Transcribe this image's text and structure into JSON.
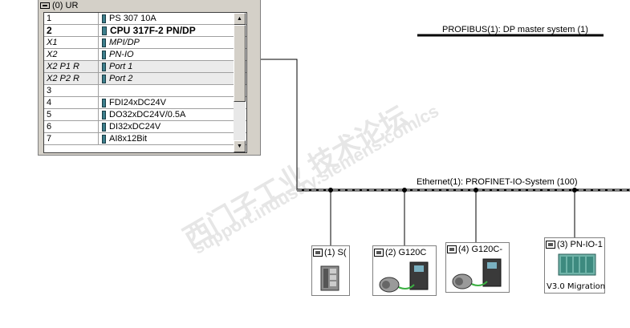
{
  "rack": {
    "title": "(0) UR",
    "slots": [
      {
        "slot": "1",
        "module": "PS 307 10A",
        "style": "normal"
      },
      {
        "slot": "2",
        "module": "CPU 317F-2 PN/DP",
        "style": "bold"
      },
      {
        "slot": "X1",
        "module": "MPI/DP",
        "style": "italic"
      },
      {
        "slot": "X2",
        "module": "PN-IO",
        "style": "italic"
      },
      {
        "slot": "X2 P1 R",
        "module": "Port 1",
        "style": "italic"
      },
      {
        "slot": "X2 P2 R",
        "module": "Port 2",
        "style": "italic"
      },
      {
        "slot": "3",
        "module": "",
        "style": "normal"
      },
      {
        "slot": "4",
        "module": "FDI24xDC24V",
        "style": "normal"
      },
      {
        "slot": "5",
        "module": "DO32xDC24V/0.5A",
        "style": "normal"
      },
      {
        "slot": "6",
        "module": "DI32xDC24V",
        "style": "normal"
      },
      {
        "slot": "7",
        "module": "AI8x12Bit",
        "style": "normal"
      }
    ]
  },
  "networks": {
    "profibus_label": "PROFIBUS(1): DP master system (1)",
    "ethernet_label": "Ethernet(1): PROFINET-IO-System (100)"
  },
  "devices": [
    {
      "label": "(1) S(",
      "footer": ""
    },
    {
      "label": "(2) G120C",
      "footer": ""
    },
    {
      "label": "(4) G120C-",
      "footer": ""
    },
    {
      "label": "(3) PN-IO-1",
      "footer": "V3.0 Migration"
    }
  ],
  "watermark": {
    "line1": "西门子工业 技术论坛",
    "line2": "support.industry.siemens.com/cs"
  },
  "colors": {
    "window_bg": "#d4d0c8",
    "module_glyph": "#3c7e8c",
    "bus_line": "#000000",
    "watermark": "#e6e6e6"
  }
}
